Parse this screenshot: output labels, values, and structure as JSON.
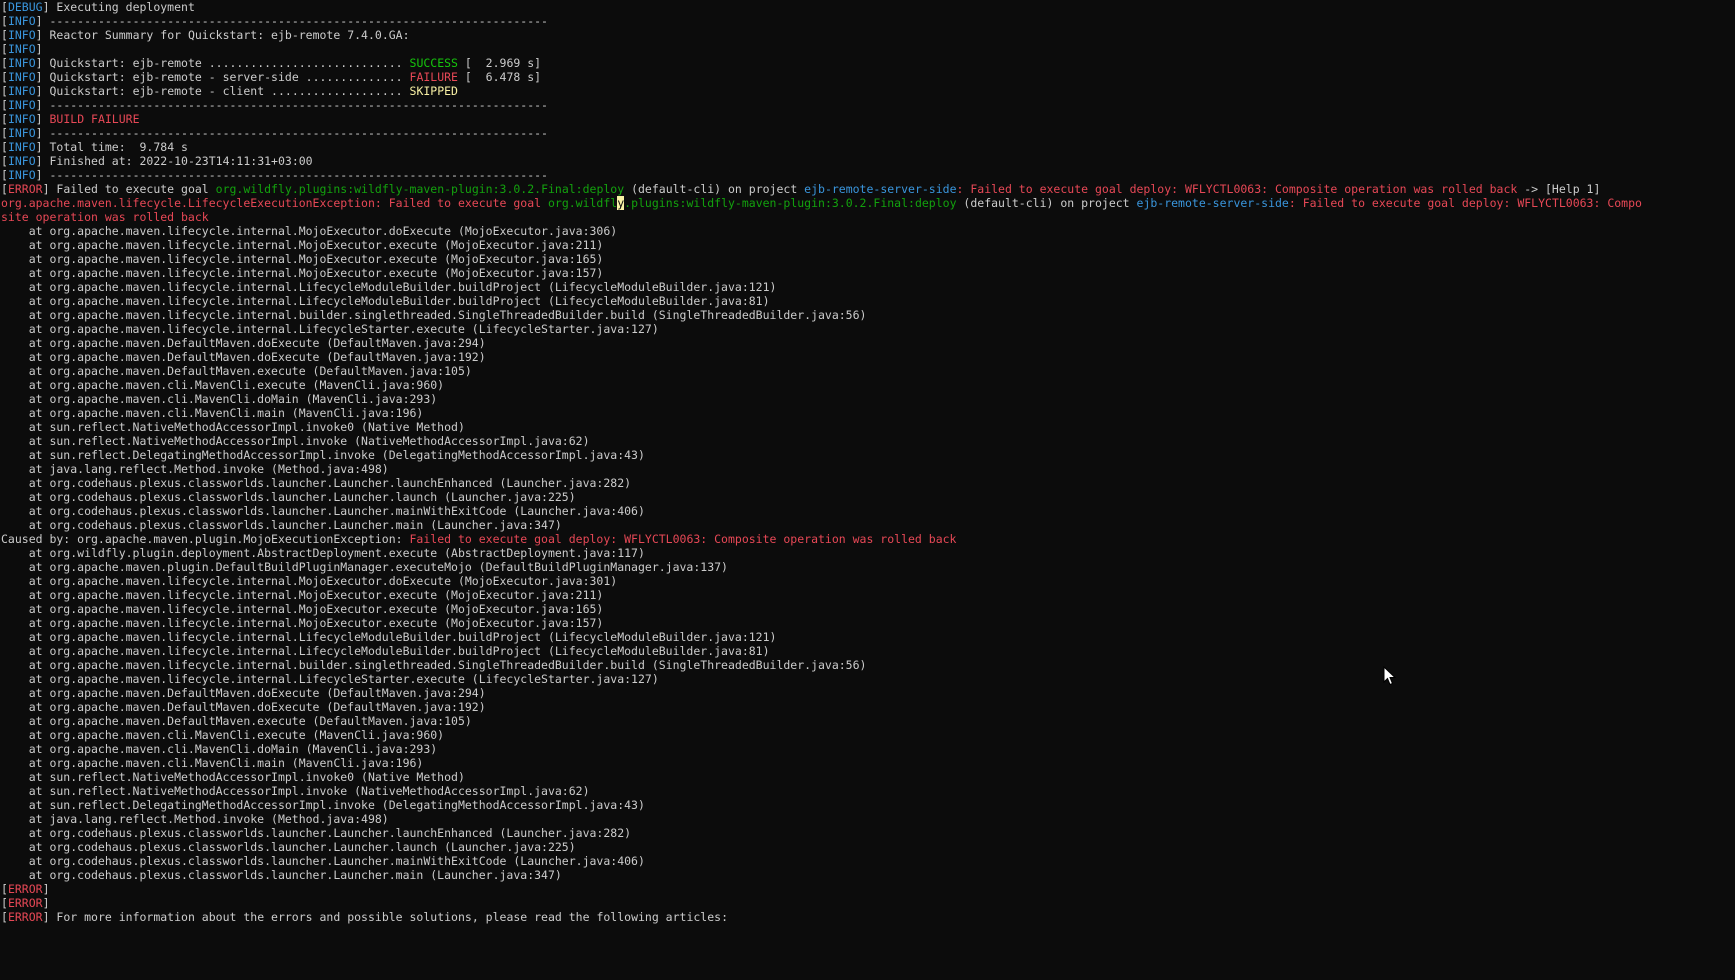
{
  "window": {
    "palette": {
      "background": "#0c0c0c",
      "default": "#cccccc",
      "info": "#3a96dd",
      "error": "#e74856",
      "success": "#16c60c",
      "warning": "#f9f1a5",
      "green": "#13a10e",
      "blue": "#3b78ff",
      "highlight": "#f9f1a5"
    }
  },
  "lines": [
    [
      [
        "default",
        "["
      ],
      [
        "info",
        "DEBUG"
      ],
      [
        "default",
        "] Executing deployment"
      ]
    ],
    [
      [
        "default",
        "["
      ],
      [
        "info",
        "INFO"
      ],
      [
        "default",
        "] ------------------------------------------------------------------------"
      ]
    ],
    [
      [
        "default",
        "["
      ],
      [
        "info",
        "INFO"
      ],
      [
        "default",
        "] Reactor Summary for Quickstart: ejb-remote 7.4.0.GA:"
      ]
    ],
    [
      [
        "default",
        "["
      ],
      [
        "info",
        "INFO"
      ],
      [
        "default",
        "]"
      ]
    ],
    [
      [
        "default",
        "["
      ],
      [
        "info",
        "INFO"
      ],
      [
        "default",
        "] Quickstart: ejb-remote ............................ "
      ],
      [
        "success",
        "SUCCESS"
      ],
      [
        "default",
        " [  2.969 s]"
      ]
    ],
    [
      [
        "default",
        "["
      ],
      [
        "info",
        "INFO"
      ],
      [
        "default",
        "] Quickstart: ejb-remote - server-side .............. "
      ],
      [
        "error",
        "FAILURE"
      ],
      [
        "default",
        " [  6.478 s]"
      ]
    ],
    [
      [
        "default",
        "["
      ],
      [
        "info",
        "INFO"
      ],
      [
        "default",
        "] Quickstart: ejb-remote - client ................... "
      ],
      [
        "warning",
        "SKIPPED"
      ]
    ],
    [
      [
        "default",
        "["
      ],
      [
        "info",
        "INFO"
      ],
      [
        "default",
        "] ------------------------------------------------------------------------"
      ]
    ],
    [
      [
        "default",
        "["
      ],
      [
        "info",
        "INFO"
      ],
      [
        "default",
        "] "
      ],
      [
        "error",
        "BUILD FAILURE"
      ]
    ],
    [
      [
        "default",
        "["
      ],
      [
        "info",
        "INFO"
      ],
      [
        "default",
        "] ------------------------------------------------------------------------"
      ]
    ],
    [
      [
        "default",
        "["
      ],
      [
        "info",
        "INFO"
      ],
      [
        "default",
        "] Total time:  9.784 s"
      ]
    ],
    [
      [
        "default",
        "["
      ],
      [
        "info",
        "INFO"
      ],
      [
        "default",
        "] Finished at: 2022-10-23T14:11:31+03:00"
      ]
    ],
    [
      [
        "default",
        "["
      ],
      [
        "info",
        "INFO"
      ],
      [
        "default",
        "] ------------------------------------------------------------------------"
      ]
    ],
    [
      [
        "default",
        "["
      ],
      [
        "error",
        "ERROR"
      ],
      [
        "default",
        "] Failed to execute goal "
      ],
      [
        "green",
        "org.wildfly.plugins:wildfly-maven-plugin:3.0.2.Final:deploy"
      ],
      [
        "default",
        " (default-cli) on project "
      ],
      [
        "info",
        "ejb-remote-server-side"
      ],
      [
        "error",
        ": Failed to execute goal deploy: WFLYCTL0063: Composite operation was rolled back"
      ],
      [
        "default",
        " -> [Help 1]"
      ]
    ],
    [
      [
        "error",
        "org.apache.maven.lifecycle.LifecycleExecutionException"
      ],
      [
        "error",
        ": Failed to execute goal "
      ],
      [
        "green",
        "org.wildfl"
      ],
      [
        "highlight",
        "y"
      ],
      [
        "green",
        ".plugins:wildfly-maven-plugin:3.0.2.Final:deploy"
      ],
      [
        "default",
        " (default-cli) on project "
      ],
      [
        "info",
        "ejb-remote-server-side"
      ],
      [
        "error",
        ": Failed to execute goal deploy: WFLYCTL0063: Compo"
      ]
    ],
    [
      [
        "error",
        "site operation was rolled back"
      ]
    ],
    [
      [
        "default",
        "    at org.apache.maven.lifecycle.internal.MojoExecutor.doExecute (MojoExecutor.java:306)"
      ]
    ],
    [
      [
        "default",
        "    at org.apache.maven.lifecycle.internal.MojoExecutor.execute (MojoExecutor.java:211)"
      ]
    ],
    [
      [
        "default",
        "    at org.apache.maven.lifecycle.internal.MojoExecutor.execute (MojoExecutor.java:165)"
      ]
    ],
    [
      [
        "default",
        "    at org.apache.maven.lifecycle.internal.MojoExecutor.execute (MojoExecutor.java:157)"
      ]
    ],
    [
      [
        "default",
        "    at org.apache.maven.lifecycle.internal.LifecycleModuleBuilder.buildProject (LifecycleModuleBuilder.java:121)"
      ]
    ],
    [
      [
        "default",
        "    at org.apache.maven.lifecycle.internal.LifecycleModuleBuilder.buildProject (LifecycleModuleBuilder.java:81)"
      ]
    ],
    [
      [
        "default",
        "    at org.apache.maven.lifecycle.internal.builder.singlethreaded.SingleThreadedBuilder.build (SingleThreadedBuilder.java:56)"
      ]
    ],
    [
      [
        "default",
        "    at org.apache.maven.lifecycle.internal.LifecycleStarter.execute (LifecycleStarter.java:127)"
      ]
    ],
    [
      [
        "default",
        "    at org.apache.maven.DefaultMaven.doExecute (DefaultMaven.java:294)"
      ]
    ],
    [
      [
        "default",
        "    at org.apache.maven.DefaultMaven.doExecute (DefaultMaven.java:192)"
      ]
    ],
    [
      [
        "default",
        "    at org.apache.maven.DefaultMaven.execute (DefaultMaven.java:105)"
      ]
    ],
    [
      [
        "default",
        "    at org.apache.maven.cli.MavenCli.execute (MavenCli.java:960)"
      ]
    ],
    [
      [
        "default",
        "    at org.apache.maven.cli.MavenCli.doMain (MavenCli.java:293)"
      ]
    ],
    [
      [
        "default",
        "    at org.apache.maven.cli.MavenCli.main (MavenCli.java:196)"
      ]
    ],
    [
      [
        "default",
        "    at sun.reflect.NativeMethodAccessorImpl.invoke0 (Native Method)"
      ]
    ],
    [
      [
        "default",
        "    at sun.reflect.NativeMethodAccessorImpl.invoke (NativeMethodAccessorImpl.java:62)"
      ]
    ],
    [
      [
        "default",
        "    at sun.reflect.DelegatingMethodAccessorImpl.invoke (DelegatingMethodAccessorImpl.java:43)"
      ]
    ],
    [
      [
        "default",
        "    at java.lang.reflect.Method.invoke (Method.java:498)"
      ]
    ],
    [
      [
        "default",
        "    at org.codehaus.plexus.classworlds.launcher.Launcher.launchEnhanced (Launcher.java:282)"
      ]
    ],
    [
      [
        "default",
        "    at org.codehaus.plexus.classworlds.launcher.Launcher.launch (Launcher.java:225)"
      ]
    ],
    [
      [
        "default",
        "    at org.codehaus.plexus.classworlds.launcher.Launcher.mainWithExitCode (Launcher.java:406)"
      ]
    ],
    [
      [
        "default",
        "    at org.codehaus.plexus.classworlds.launcher.Launcher.main (Launcher.java:347)"
      ]
    ],
    [
      [
        "default",
        "Caused by: org.apache.maven.plugin.MojoExecutionException: "
      ],
      [
        "error",
        "Failed to execute goal deploy: WFLYCTL0063: Composite operation was rolled back"
      ]
    ],
    [
      [
        "default",
        "    at org.wildfly.plugin.deployment.AbstractDeployment.execute (AbstractDeployment.java:117)"
      ]
    ],
    [
      [
        "default",
        "    at org.apache.maven.plugin.DefaultBuildPluginManager.executeMojo (DefaultBuildPluginManager.java:137)"
      ]
    ],
    [
      [
        "default",
        "    at org.apache.maven.lifecycle.internal.MojoExecutor.doExecute (MojoExecutor.java:301)"
      ]
    ],
    [
      [
        "default",
        "    at org.apache.maven.lifecycle.internal.MojoExecutor.execute (MojoExecutor.java:211)"
      ]
    ],
    [
      [
        "default",
        "    at org.apache.maven.lifecycle.internal.MojoExecutor.execute (MojoExecutor.java:165)"
      ]
    ],
    [
      [
        "default",
        "    at org.apache.maven.lifecycle.internal.MojoExecutor.execute (MojoExecutor.java:157)"
      ]
    ],
    [
      [
        "default",
        "    at org.apache.maven.lifecycle.internal.LifecycleModuleBuilder.buildProject (LifecycleModuleBuilder.java:121)"
      ]
    ],
    [
      [
        "default",
        "    at org.apache.maven.lifecycle.internal.LifecycleModuleBuilder.buildProject (LifecycleModuleBuilder.java:81)"
      ]
    ],
    [
      [
        "default",
        "    at org.apache.maven.lifecycle.internal.builder.singlethreaded.SingleThreadedBuilder.build (SingleThreadedBuilder.java:56)"
      ]
    ],
    [
      [
        "default",
        "    at org.apache.maven.lifecycle.internal.LifecycleStarter.execute (LifecycleStarter.java:127)"
      ]
    ],
    [
      [
        "default",
        "    at org.apache.maven.DefaultMaven.doExecute (DefaultMaven.java:294)"
      ]
    ],
    [
      [
        "default",
        "    at org.apache.maven.DefaultMaven.doExecute (DefaultMaven.java:192)"
      ]
    ],
    [
      [
        "default",
        "    at org.apache.maven.DefaultMaven.execute (DefaultMaven.java:105)"
      ]
    ],
    [
      [
        "default",
        "    at org.apache.maven.cli.MavenCli.execute (MavenCli.java:960)"
      ]
    ],
    [
      [
        "default",
        "    at org.apache.maven.cli.MavenCli.doMain (MavenCli.java:293)"
      ]
    ],
    [
      [
        "default",
        "    at org.apache.maven.cli.MavenCli.main (MavenCli.java:196)"
      ]
    ],
    [
      [
        "default",
        "    at sun.reflect.NativeMethodAccessorImpl.invoke0 (Native Method)"
      ]
    ],
    [
      [
        "default",
        "    at sun.reflect.NativeMethodAccessorImpl.invoke (NativeMethodAccessorImpl.java:62)"
      ]
    ],
    [
      [
        "default",
        "    at sun.reflect.DelegatingMethodAccessorImpl.invoke (DelegatingMethodAccessorImpl.java:43)"
      ]
    ],
    [
      [
        "default",
        "    at java.lang.reflect.Method.invoke (Method.java:498)"
      ]
    ],
    [
      [
        "default",
        "    at org.codehaus.plexus.classworlds.launcher.Launcher.launchEnhanced (Launcher.java:282)"
      ]
    ],
    [
      [
        "default",
        "    at org.codehaus.plexus.classworlds.launcher.Launcher.launch (Launcher.java:225)"
      ]
    ],
    [
      [
        "default",
        "    at org.codehaus.plexus.classworlds.launcher.Launcher.mainWithExitCode (Launcher.java:406)"
      ]
    ],
    [
      [
        "default",
        "    at org.codehaus.plexus.classworlds.launcher.Launcher.main (Launcher.java:347)"
      ]
    ],
    [
      [
        "default",
        "["
      ],
      [
        "error",
        "ERROR"
      ],
      [
        "default",
        "]"
      ]
    ],
    [
      [
        "default",
        "["
      ],
      [
        "error",
        "ERROR"
      ],
      [
        "default",
        "]"
      ]
    ],
    [
      [
        "default",
        "["
      ],
      [
        "error",
        "ERROR"
      ],
      [
        "default",
        "] For more information about the errors and possible solutions, please read the following articles:"
      ]
    ]
  ],
  "pointer": {
    "icon": "mouse-pointer-icon"
  }
}
